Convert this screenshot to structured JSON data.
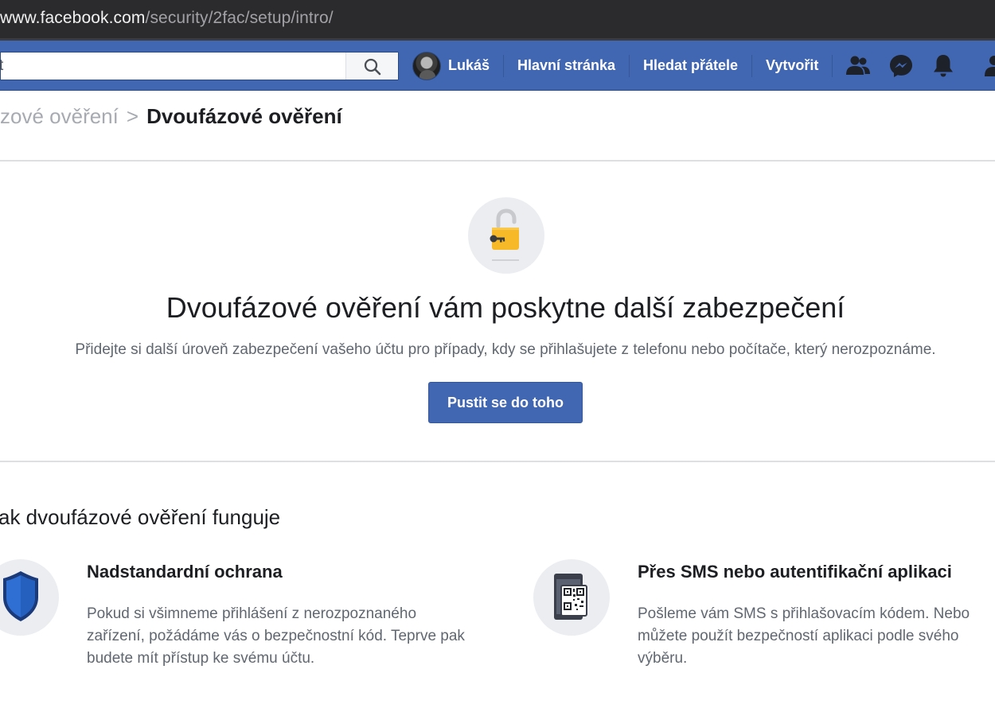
{
  "browser": {
    "url_host": "www.facebook.com",
    "url_path": "/security/2fac/setup/intro/"
  },
  "topbar": {
    "search_value": "t",
    "profile_name": "Lukáš",
    "nav": {
      "home": "Hlavní stránka",
      "find_friends": "Hledat přátele",
      "create": "Vytvořit"
    },
    "icons": [
      "friends-icon",
      "messenger-icon",
      "notifications-icon",
      "help-icon"
    ],
    "brand_color": "#4267b2"
  },
  "breadcrumb": {
    "parent": "zové ověření",
    "separator": ">",
    "current": "Dvoufázové ověření"
  },
  "hero": {
    "icon": "padlock-key-icon",
    "title": "Dvoufázové ověření vám poskytne další zabezpečení",
    "subtitle": "Přidejte si další úroveň zabezpečení vašeho účtu pro případy, kdy se přihlašujete z telefonu nebo počítače, který nerozpoznáme.",
    "cta_label": "Pustit se do toho",
    "accent_color": "#f7b928"
  },
  "how": {
    "title": "ak dvoufázové ověření funguje",
    "features": [
      {
        "icon": "shield-icon",
        "title": "Nadstandardní ochrana",
        "lines": [
          "Pokud si všimneme přihlášení z nerozpoznaného",
          "zařízení, požádáme vás o bezpečnostní kód. Teprve pak",
          "budete mít přístup ke svému účtu."
        ]
      },
      {
        "icon": "phone-qr-icon",
        "title": "Přes SMS nebo autentifikační aplikaci",
        "lines": [
          "Pošleme vám SMS s přihlašovacím kódem. Nebo",
          "můžete použít bezpečností aplikaci podle svého",
          "výběru."
        ]
      }
    ]
  }
}
